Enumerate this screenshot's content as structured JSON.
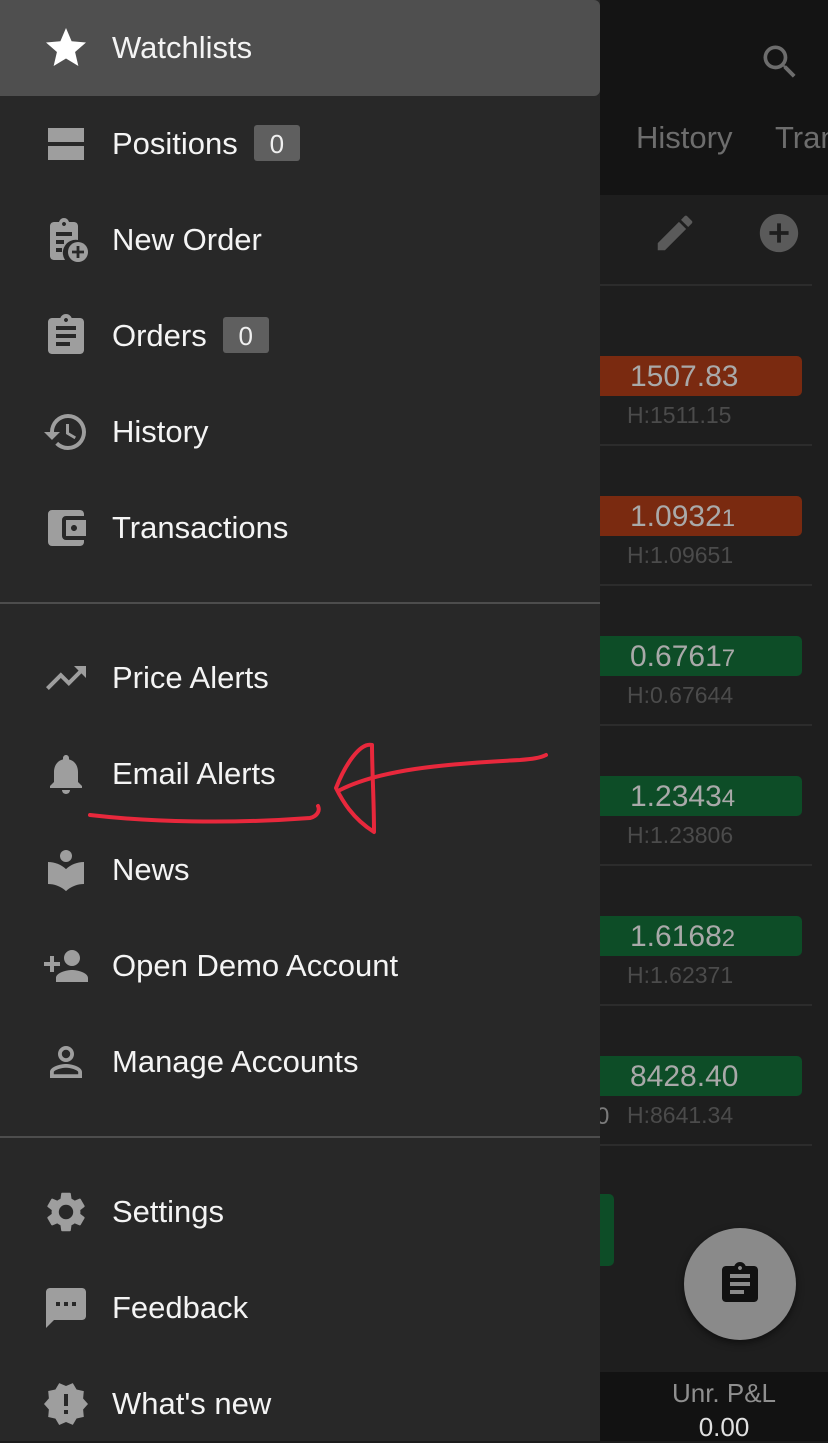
{
  "background": {
    "tabs": [
      "History",
      "Tran"
    ],
    "quotes": [
      {
        "price": "1507.83",
        "price_small": "",
        "high": "H:1511.15",
        "color": "red"
      },
      {
        "price": "1.0932",
        "price_small": "1",
        "high": "H:1.09651",
        "color": "red"
      },
      {
        "price": "0.6761",
        "price_small": "7",
        "high": "H:0.67644",
        "color": "green"
      },
      {
        "price": "1.2343",
        "price_small": "4",
        "high": "H:1.23806",
        "color": "green"
      },
      {
        "price": "1.6168",
        "price_small": "2",
        "high": "H:1.62371",
        "color": "green"
      },
      {
        "price": "8428.40",
        "price_small": "",
        "high": "H:8641.34",
        "color": "green"
      }
    ],
    "partial_text": "0",
    "bottom_bar": {
      "label": "Unr. P&L",
      "value": "0.00"
    }
  },
  "drawer": {
    "items": [
      {
        "label": "Watchlists",
        "icon": "star-icon",
        "badge": null
      },
      {
        "label": "Positions",
        "icon": "positions-icon",
        "badge": "0"
      },
      {
        "label": "New Order",
        "icon": "new-order-icon",
        "badge": null
      },
      {
        "label": "Orders",
        "icon": "orders-icon",
        "badge": "0"
      },
      {
        "label": "History",
        "icon": "history-icon",
        "badge": null
      },
      {
        "label": "Transactions",
        "icon": "wallet-icon",
        "badge": null
      },
      {
        "label": "Price Alerts",
        "icon": "trending-up-icon",
        "badge": null
      },
      {
        "label": "Email Alerts",
        "icon": "bell-icon",
        "badge": null
      },
      {
        "label": "News",
        "icon": "news-icon",
        "badge": null
      },
      {
        "label": "Open Demo Account",
        "icon": "add-person-icon",
        "badge": null
      },
      {
        "label": "Manage Accounts",
        "icon": "person-icon",
        "badge": null
      },
      {
        "label": "Settings",
        "icon": "gear-icon",
        "badge": null
      },
      {
        "label": "Feedback",
        "icon": "feedback-icon",
        "badge": null
      },
      {
        "label": "What's new",
        "icon": "new-releases-icon",
        "badge": null
      }
    ]
  },
  "colors": {
    "drawer_bg": "#282828",
    "active_item_bg": "#4f4f4f",
    "annotation": "#e8283c",
    "price_down": "#7a2a10",
    "price_up": "#0d4d27"
  }
}
